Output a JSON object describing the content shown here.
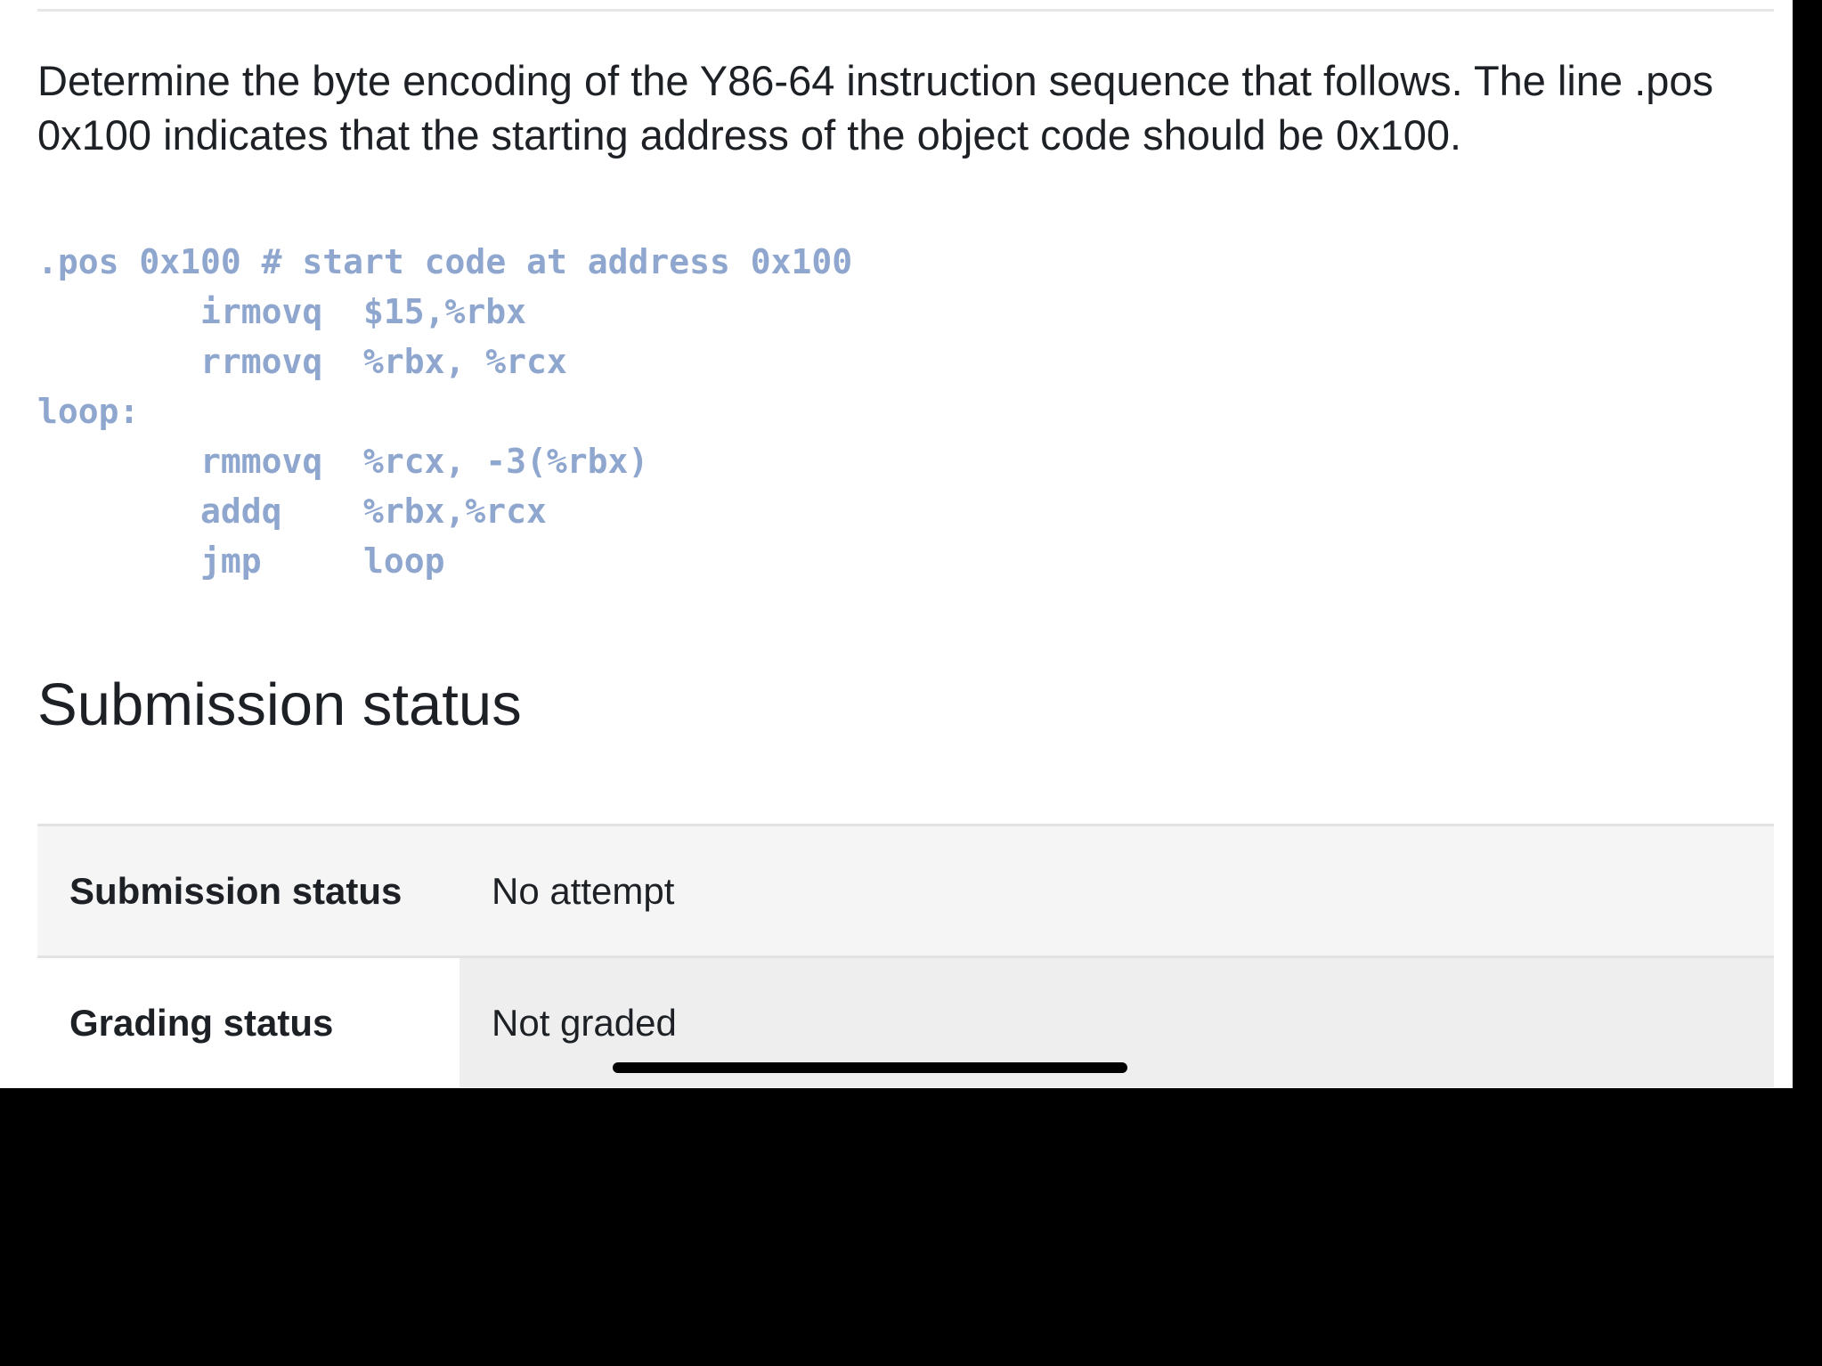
{
  "question": {
    "text": "Determine the byte encoding of the Y86-64 instruction sequence that follows. The line .pos 0x100 indicates that the starting address of the object code should be 0x100."
  },
  "code": {
    "pos_line": ".pos 0x100 # start code at address 0x100",
    "instructions": [
      {
        "op": "irmovq",
        "args": "$15,%rbx"
      },
      {
        "op": "rrmovq",
        "args": "%rbx, %rcx"
      }
    ],
    "label": "loop:",
    "loop_instructions": [
      {
        "op": "rmmovq",
        "args": "%rcx, -3(%rbx)"
      },
      {
        "op": "addq",
        "args": "%rbx,%rcx"
      },
      {
        "op": "jmp",
        "args": "loop"
      }
    ]
  },
  "submission": {
    "heading": "Submission status",
    "rows": [
      {
        "label": "Submission status",
        "value": "No attempt"
      },
      {
        "label": "Grading status",
        "value": "Not graded"
      }
    ]
  },
  "colors": {
    "code": "#8fa7cf",
    "text": "#1d2125",
    "row_bg": "#f5f5f5"
  }
}
